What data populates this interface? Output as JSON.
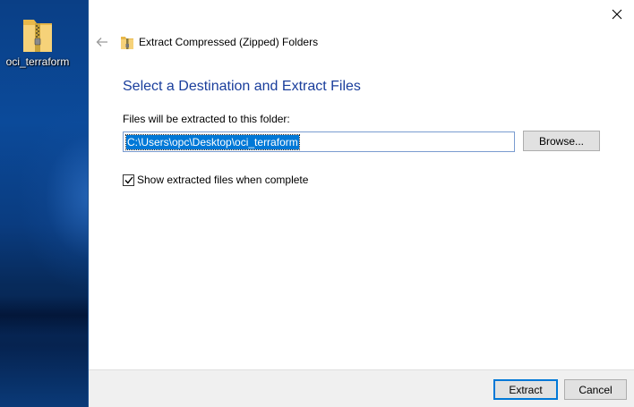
{
  "desktop": {
    "icon_label": "oci_terraform",
    "icon_name": "zip-folder-icon"
  },
  "dialog": {
    "title": "Extract Compressed (Zipped) Folders",
    "heading": "Select a Destination and Extract Files",
    "field_label": "Files will be extracted to this folder:",
    "destination_value": "C:\\Users\\opc\\Desktop\\oci_terraform",
    "browse_label": "Browse...",
    "show_files_label": "Show extracted files when complete",
    "show_files_checked": true,
    "extract_label": "Extract",
    "cancel_label": "Cancel"
  },
  "colors": {
    "heading": "#1a3e9c",
    "selection": "#0078d7",
    "desktop": "#0a3f86"
  }
}
